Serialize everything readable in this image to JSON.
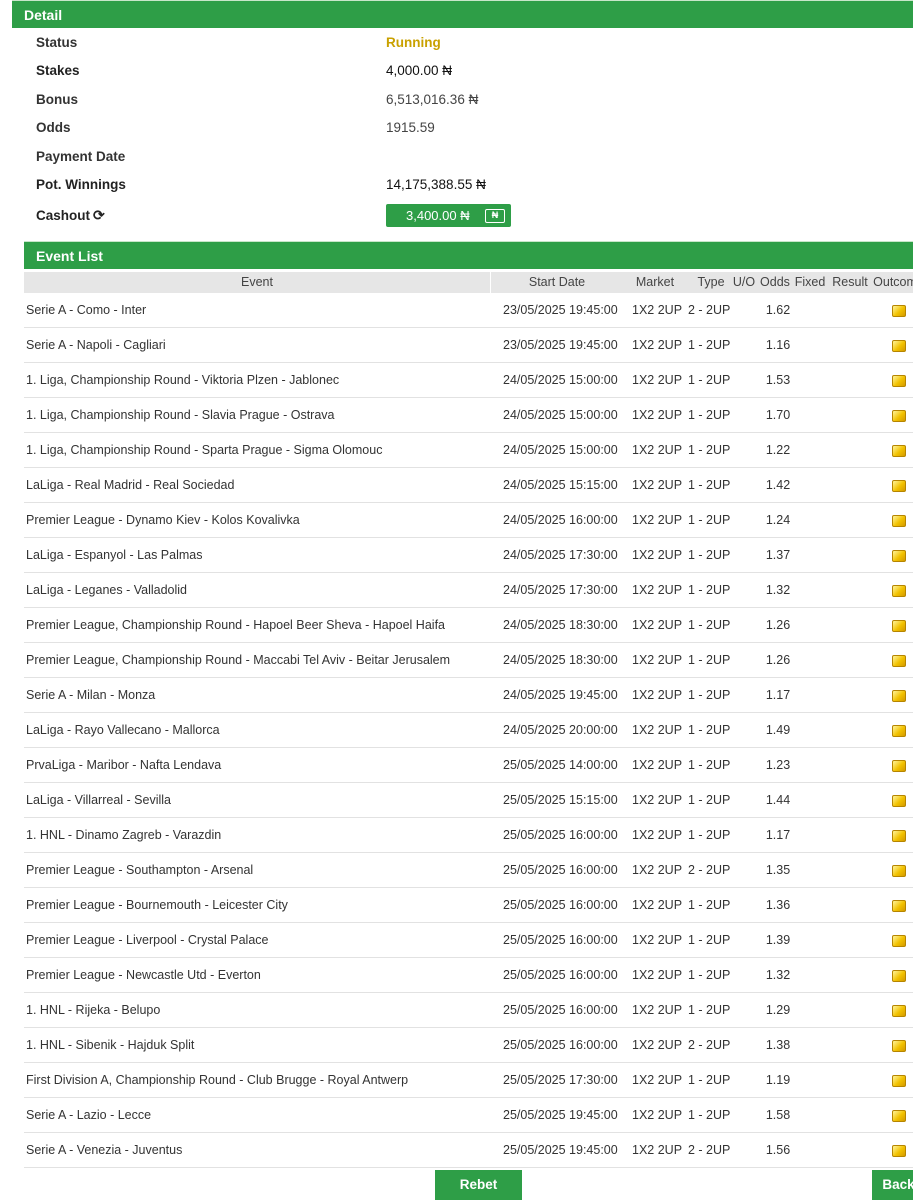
{
  "detail": {
    "title": "Detail",
    "status_label": "Status",
    "status_value": "Running",
    "stakes_label": "Stakes",
    "stakes_value": "4,000.00 ₦",
    "bonus_label": "Bonus",
    "bonus_value": "6,513,016.36 ₦",
    "odds_label": "Odds",
    "odds_value": "1915.59",
    "payment_date_label": "Payment Date",
    "payment_date_value": "",
    "pot_winnings_label": "Pot. Winnings",
    "pot_winnings_value": "14,175,388.55 ₦",
    "cashout_label": "Cashout",
    "cashout_value": "3,400.00 ₦",
    "cashout_icon_glyph": "₦",
    "cashout_refresh_glyph": "⟳",
    "status_color": "#c9a100",
    "accent_color": "#2e9e47"
  },
  "events": {
    "title": "Event List",
    "columns": {
      "event": "Event",
      "start": "Start Date",
      "market": "Market",
      "type": "Type",
      "uo": "U/O",
      "odds": "Odds",
      "fixed": "Fixed",
      "result": "Result",
      "outcome": "Outcome"
    },
    "rows": [
      {
        "event": "Serie A - Como - Inter",
        "start": "23/05/2025 19:45:00",
        "market": "1X2 2UP",
        "type": "2 - 2UP",
        "odds": "1.62",
        "outcome_icon": "pending-icon"
      },
      {
        "event": "Serie A - Napoli - Cagliari",
        "start": "23/05/2025 19:45:00",
        "market": "1X2 2UP",
        "type": "1 - 2UP",
        "odds": "1.16",
        "outcome_icon": "pending-icon"
      },
      {
        "event": "1. Liga, Championship Round - Viktoria Plzen - Jablonec",
        "start": "24/05/2025 15:00:00",
        "market": "1X2 2UP",
        "type": "1 - 2UP",
        "odds": "1.53",
        "outcome_icon": "pending-icon"
      },
      {
        "event": "1. Liga, Championship Round - Slavia Prague - Ostrava",
        "start": "24/05/2025 15:00:00",
        "market": "1X2 2UP",
        "type": "1 - 2UP",
        "odds": "1.70",
        "outcome_icon": "pending-icon"
      },
      {
        "event": "1. Liga, Championship Round - Sparta Prague - Sigma Olomouc",
        "start": "24/05/2025 15:00:00",
        "market": "1X2 2UP",
        "type": "1 - 2UP",
        "odds": "1.22",
        "outcome_icon": "pending-icon"
      },
      {
        "event": "LaLiga - Real Madrid - Real Sociedad",
        "start": "24/05/2025 15:15:00",
        "market": "1X2 2UP",
        "type": "1 - 2UP",
        "odds": "1.42",
        "outcome_icon": "pending-icon"
      },
      {
        "event": "Premier League - Dynamo Kiev - Kolos Kovalivka",
        "start": "24/05/2025 16:00:00",
        "market": "1X2 2UP",
        "type": "1 - 2UP",
        "odds": "1.24",
        "outcome_icon": "pending-icon"
      },
      {
        "event": "LaLiga - Espanyol - Las Palmas",
        "start": "24/05/2025 17:30:00",
        "market": "1X2 2UP",
        "type": "1 - 2UP",
        "odds": "1.37",
        "outcome_icon": "pending-icon"
      },
      {
        "event": "LaLiga - Leganes - Valladolid",
        "start": "24/05/2025 17:30:00",
        "market": "1X2 2UP",
        "type": "1 - 2UP",
        "odds": "1.32",
        "outcome_icon": "pending-icon"
      },
      {
        "event": "Premier League, Championship Round - Hapoel Beer Sheva - Hapoel Haifa",
        "start": "24/05/2025 18:30:00",
        "market": "1X2 2UP",
        "type": "1 - 2UP",
        "odds": "1.26",
        "outcome_icon": "pending-icon"
      },
      {
        "event": "Premier League, Championship Round - Maccabi Tel Aviv - Beitar Jerusalem",
        "start": "24/05/2025 18:30:00",
        "market": "1X2 2UP",
        "type": "1 - 2UP",
        "odds": "1.26",
        "outcome_icon": "pending-icon"
      },
      {
        "event": "Serie A - Milan - Monza",
        "start": "24/05/2025 19:45:00",
        "market": "1X2 2UP",
        "type": "1 - 2UP",
        "odds": "1.17",
        "outcome_icon": "pending-icon"
      },
      {
        "event": "LaLiga - Rayo Vallecano - Mallorca",
        "start": "24/05/2025 20:00:00",
        "market": "1X2 2UP",
        "type": "1 - 2UP",
        "odds": "1.49",
        "outcome_icon": "pending-icon"
      },
      {
        "event": "PrvaLiga - Maribor - Nafta Lendava",
        "start": "25/05/2025 14:00:00",
        "market": "1X2 2UP",
        "type": "1 - 2UP",
        "odds": "1.23",
        "outcome_icon": "pending-icon"
      },
      {
        "event": "LaLiga - Villarreal - Sevilla",
        "start": "25/05/2025 15:15:00",
        "market": "1X2 2UP",
        "type": "1 - 2UP",
        "odds": "1.44",
        "outcome_icon": "pending-icon"
      },
      {
        "event": "1. HNL - Dinamo Zagreb - Varazdin",
        "start": "25/05/2025 16:00:00",
        "market": "1X2 2UP",
        "type": "1 - 2UP",
        "odds": "1.17",
        "outcome_icon": "pending-icon"
      },
      {
        "event": "Premier League - Southampton - Arsenal",
        "start": "25/05/2025 16:00:00",
        "market": "1X2 2UP",
        "type": "2 - 2UP",
        "odds": "1.35",
        "outcome_icon": "pending-icon"
      },
      {
        "event": "Premier League - Bournemouth - Leicester City",
        "start": "25/05/2025 16:00:00",
        "market": "1X2 2UP",
        "type": "1 - 2UP",
        "odds": "1.36",
        "outcome_icon": "pending-icon"
      },
      {
        "event": "Premier League - Liverpool - Crystal Palace",
        "start": "25/05/2025 16:00:00",
        "market": "1X2 2UP",
        "type": "1 - 2UP",
        "odds": "1.39",
        "outcome_icon": "pending-icon"
      },
      {
        "event": "Premier League - Newcastle Utd - Everton",
        "start": "25/05/2025 16:00:00",
        "market": "1X2 2UP",
        "type": "1 - 2UP",
        "odds": "1.32",
        "outcome_icon": "pending-icon"
      },
      {
        "event": "1. HNL - Rijeka - Belupo",
        "start": "25/05/2025 16:00:00",
        "market": "1X2 2UP",
        "type": "1 - 2UP",
        "odds": "1.29",
        "outcome_icon": "pending-icon"
      },
      {
        "event": "1. HNL - Sibenik - Hajduk Split",
        "start": "25/05/2025 16:00:00",
        "market": "1X2 2UP",
        "type": "2 - 2UP",
        "odds": "1.38",
        "outcome_icon": "pending-icon"
      },
      {
        "event": "First Division A, Championship Round - Club Brugge - Royal Antwerp",
        "start": "25/05/2025 17:30:00",
        "market": "1X2 2UP",
        "type": "1 - 2UP",
        "odds": "1.19",
        "outcome_icon": "pending-icon"
      },
      {
        "event": "Serie A - Lazio - Lecce",
        "start": "25/05/2025 19:45:00",
        "market": "1X2 2UP",
        "type": "1 - 2UP",
        "odds": "1.58",
        "outcome_icon": "pending-icon"
      },
      {
        "event": "Serie A - Venezia - Juventus",
        "start": "25/05/2025 19:45:00",
        "market": "1X2 2UP",
        "type": "2 - 2UP",
        "odds": "1.56",
        "outcome_icon": "pending-icon"
      }
    ]
  },
  "footer": {
    "rebet_label": "Rebet",
    "back_label": "Back"
  }
}
